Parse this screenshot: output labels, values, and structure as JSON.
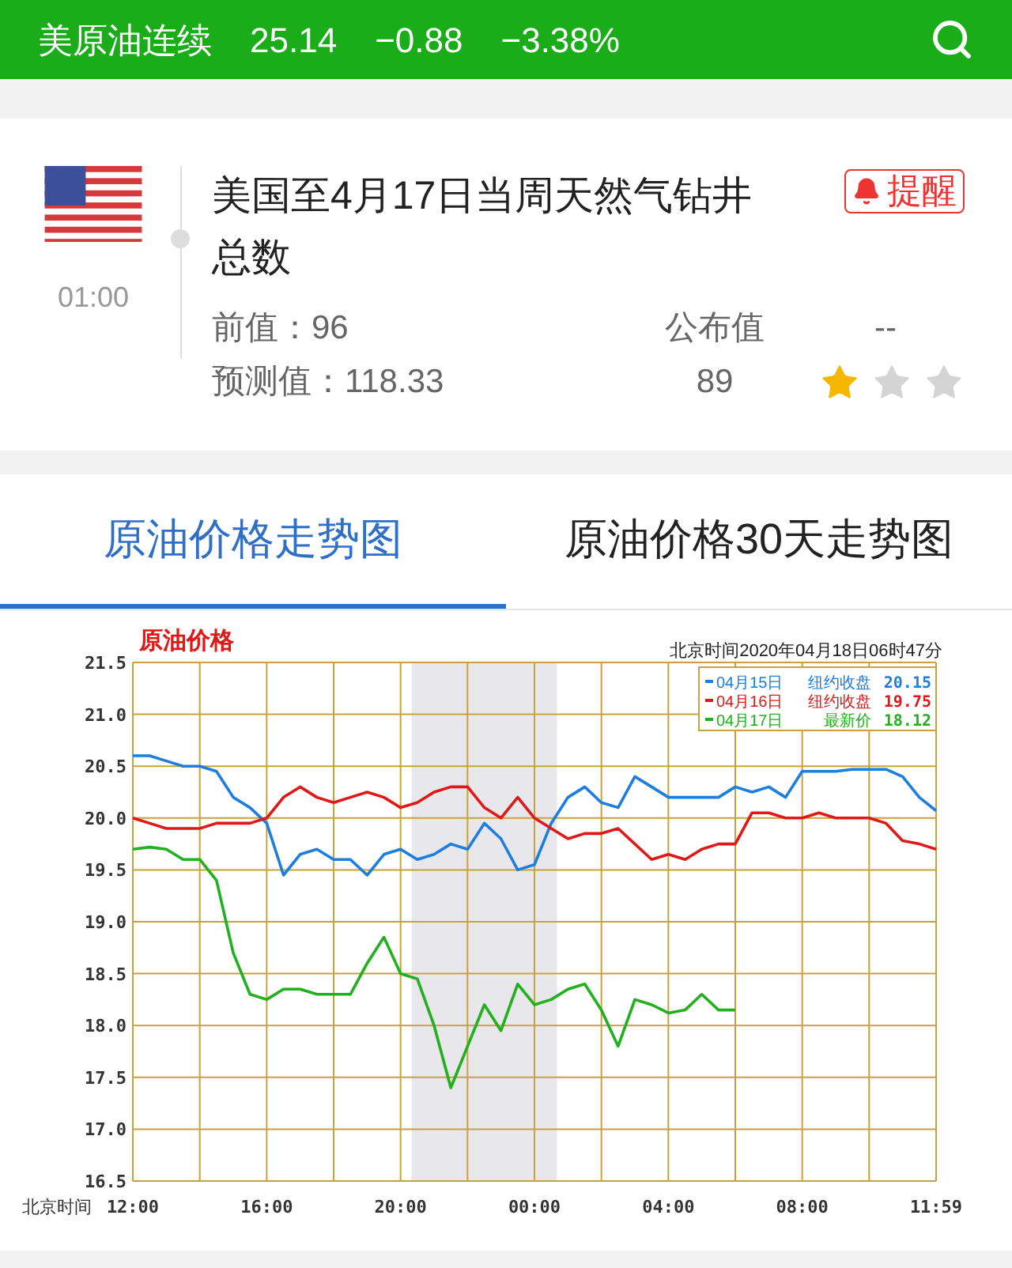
{
  "ticker": {
    "name": "美原油连续",
    "price": "25.14",
    "change": "−0.88",
    "change_pct": "−3.38%"
  },
  "event": {
    "time": "01:00",
    "title": "美国至4月17日当周天然气钻井总数",
    "alert_label": "提醒",
    "previous_label": "前值：",
    "previous": "96",
    "forecast_label": "预测值：",
    "forecast": "118.33",
    "actual_label": "公布值",
    "actual": "--",
    "actual_value": "89",
    "stars": 1
  },
  "tabs": [
    {
      "label": "原油价格走势图",
      "selected": true
    },
    {
      "label": "原油价格30天走势图",
      "selected": false
    }
  ],
  "chart": {
    "chart_data": {
      "type": "line",
      "title": "原油价格",
      "subtitle": "北京时间2020年04月18日06时47分",
      "xlabel": "北京时间",
      "ylim": [
        16.5,
        21.5
      ],
      "yticks": [
        {
          "value": 16.5,
          "label": "16.5"
        },
        {
          "value": 17,
          "label": "17.0"
        },
        {
          "value": 17.5,
          "label": "17.5"
        },
        {
          "value": 18,
          "label": "18.0"
        },
        {
          "value": 18.5,
          "label": "18.5"
        },
        {
          "value": 19,
          "label": "19.0"
        },
        {
          "value": 19.5,
          "label": "19.5"
        },
        {
          "value": 20,
          "label": "20.0"
        },
        {
          "value": 20.5,
          "label": "20.5"
        },
        {
          "value": 21,
          "label": "21.0"
        },
        {
          "value": 21.5,
          "label": "21.5"
        }
      ],
      "categories": [
        "12:00",
        null,
        null,
        null,
        null,
        null,
        null,
        null,
        "16:00",
        null,
        null,
        null,
        null,
        null,
        null,
        null,
        "20:00",
        null,
        null,
        null,
        null,
        null,
        null,
        null,
        "00:00",
        null,
        null,
        null,
        null,
        null,
        null,
        null,
        "04:00",
        null,
        null,
        null,
        null,
        null,
        null,
        null,
        "08:00",
        null,
        null,
        null,
        null,
        null,
        null,
        null,
        "11:59"
      ],
      "grid": true,
      "legend": true,
      "series": [
        {
          "name": "04月15日",
          "color": "#1e7ee0",
          "values": [
            20.6,
            20.6,
            20.55,
            20.5,
            20.5,
            20.45,
            20.2,
            20.1,
            19.95,
            19.45,
            19.65,
            19.7,
            19.6,
            19.6,
            19.45,
            19.65,
            19.7,
            19.6,
            19.65,
            19.75,
            19.7,
            19.95,
            19.8,
            19.5,
            19.55,
            19.95,
            20.2,
            20.3,
            20.15,
            20.1,
            20.4,
            20.3,
            20.2,
            20.2,
            20.2,
            20.2,
            20.3,
            20.25,
            20.3,
            20.2,
            20.45,
            20.45,
            20.45,
            20.47,
            20.47,
            20.47,
            20.4,
            20.2,
            20.07
          ]
        },
        {
          "name": "04月16日",
          "color": "#e01818",
          "values": [
            20.0,
            19.95,
            19.9,
            19.9,
            19.9,
            19.95,
            19.95,
            19.95,
            20.0,
            20.2,
            20.3,
            20.2,
            20.15,
            20.2,
            20.25,
            20.2,
            20.1,
            20.15,
            20.25,
            20.3,
            20.3,
            20.1,
            20.0,
            20.2,
            20.0,
            19.9,
            19.8,
            19.85,
            19.85,
            19.9,
            19.75,
            19.6,
            19.65,
            19.6,
            19.7,
            19.75,
            19.75,
            20.05,
            20.05,
            20.0,
            20.0,
            20.05,
            20.0,
            20.0,
            20.0,
            19.95,
            19.78,
            19.75,
            19.7
          ]
        },
        {
          "name": "04月17日",
          "color": "#22b01e",
          "values": [
            19.7,
            19.72,
            19.7,
            19.6,
            19.6,
            19.4,
            18.7,
            18.3,
            18.25,
            18.35,
            18.35,
            18.3,
            18.3,
            18.3,
            18.6,
            18.85,
            18.5,
            18.45,
            18.0,
            17.4,
            17.8,
            18.2,
            17.95,
            18.4,
            18.2,
            18.25,
            18.35,
            18.4,
            18.15,
            17.8,
            18.25,
            18.2,
            18.12,
            18.15,
            18.3,
            18.15,
            18.15,
            null,
            null,
            null,
            null,
            null,
            null,
            null,
            null,
            null,
            null,
            null,
            null
          ]
        }
      ]
    },
    "legend": [
      {
        "label": "纽约收盘",
        "value": "20.15"
      },
      {
        "label": "纽约收盘",
        "value": "19.75"
      },
      {
        "label": "最新价",
        "value": "18.12"
      }
    ]
  }
}
